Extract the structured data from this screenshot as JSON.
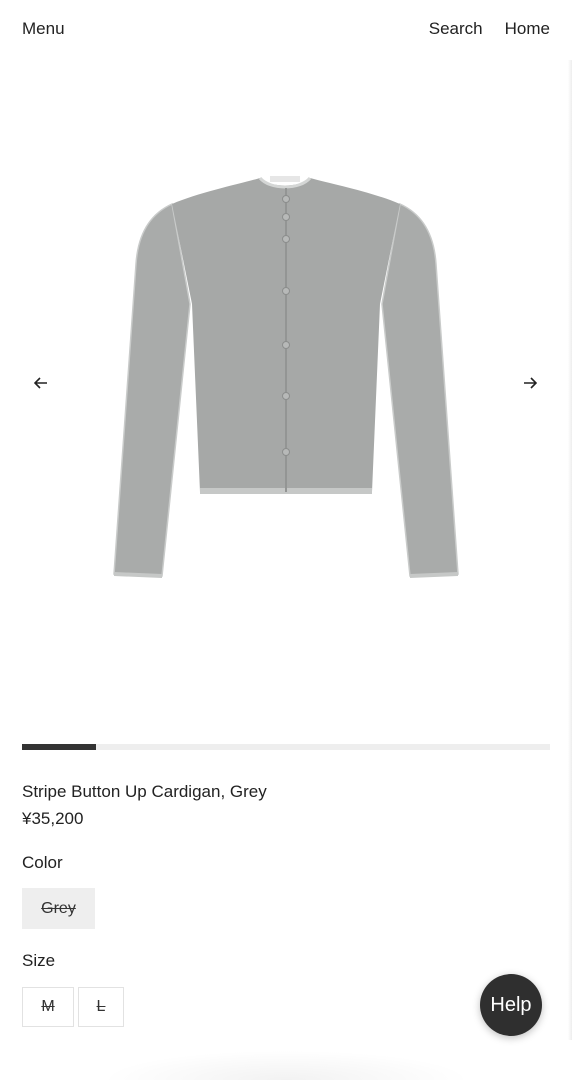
{
  "header": {
    "menu_label": "Menu",
    "search_label": "Search",
    "home_label": "Home"
  },
  "gallery": {
    "prev_icon": "arrow-left-icon",
    "next_icon": "arrow-right-icon",
    "progress_fraction": 0.14
  },
  "product": {
    "title": "Stripe Button Up Cardigan, Grey",
    "price": "¥35,200"
  },
  "color": {
    "label": "Color",
    "options": [
      {
        "label": "Grey",
        "available": false,
        "selected": true
      }
    ]
  },
  "size": {
    "label": "Size",
    "options": [
      {
        "label": "M",
        "available": false
      },
      {
        "label": "L",
        "available": false
      }
    ]
  },
  "help": {
    "label": "Help"
  },
  "colors": {
    "garment": "#a9abaa",
    "progress_fill": "#333333",
    "progress_track": "#eeeeee",
    "help_bg": "#2f2f2f"
  }
}
